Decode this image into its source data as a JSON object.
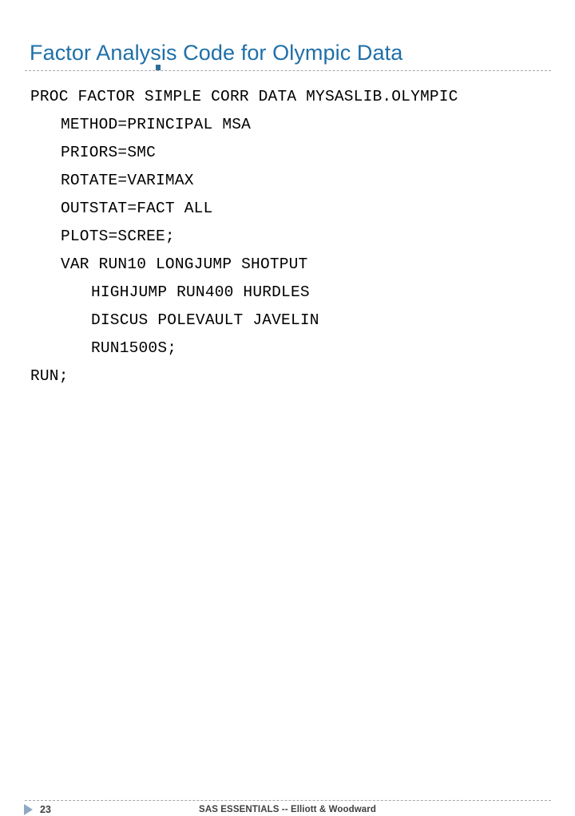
{
  "slide": {
    "title": "Factor Analysis Code for Olympic Data",
    "accent_color": "#1F6FA8",
    "rule_color": "#A6A6A6",
    "marker_color": "#2E6E96",
    "background_color": "#FFFFFF"
  },
  "code": {
    "language": "SAS",
    "text_color": "#000000",
    "lines": [
      {
        "indent": 0,
        "text": "PROC FACTOR SIMPLE CORR DATA MYSASLIB.OLYMPIC"
      },
      {
        "indent": 1,
        "text": "METHOD=PRINCIPAL MSA"
      },
      {
        "indent": 1,
        "text": "PRIORS=SMC"
      },
      {
        "indent": 1,
        "text": "ROTATE=VARIMAX"
      },
      {
        "indent": 1,
        "text": "OUTSTAT=FACT ALL"
      },
      {
        "indent": 1,
        "text": "PLOTS=SCREE;"
      },
      {
        "indent": 1,
        "text": "VAR RUN10 LONGJUMP SHOTPUT"
      },
      {
        "indent": 2,
        "text": "HIGHJUMP RUN400 HURDLES"
      },
      {
        "indent": 2,
        "text": "DISCUS POLEVAULT JAVELIN"
      },
      {
        "indent": 2,
        "text": "RUN1500S;"
      },
      {
        "indent": 0,
        "text": "RUN;"
      }
    ]
  },
  "footer": {
    "arrow_icon": "triangle-right-icon",
    "arrow_color": "#8FA8C4",
    "slide_number": "23",
    "credit": "SAS ESSENTIALS -- Elliott & Woodward",
    "text_color": "#404040"
  }
}
